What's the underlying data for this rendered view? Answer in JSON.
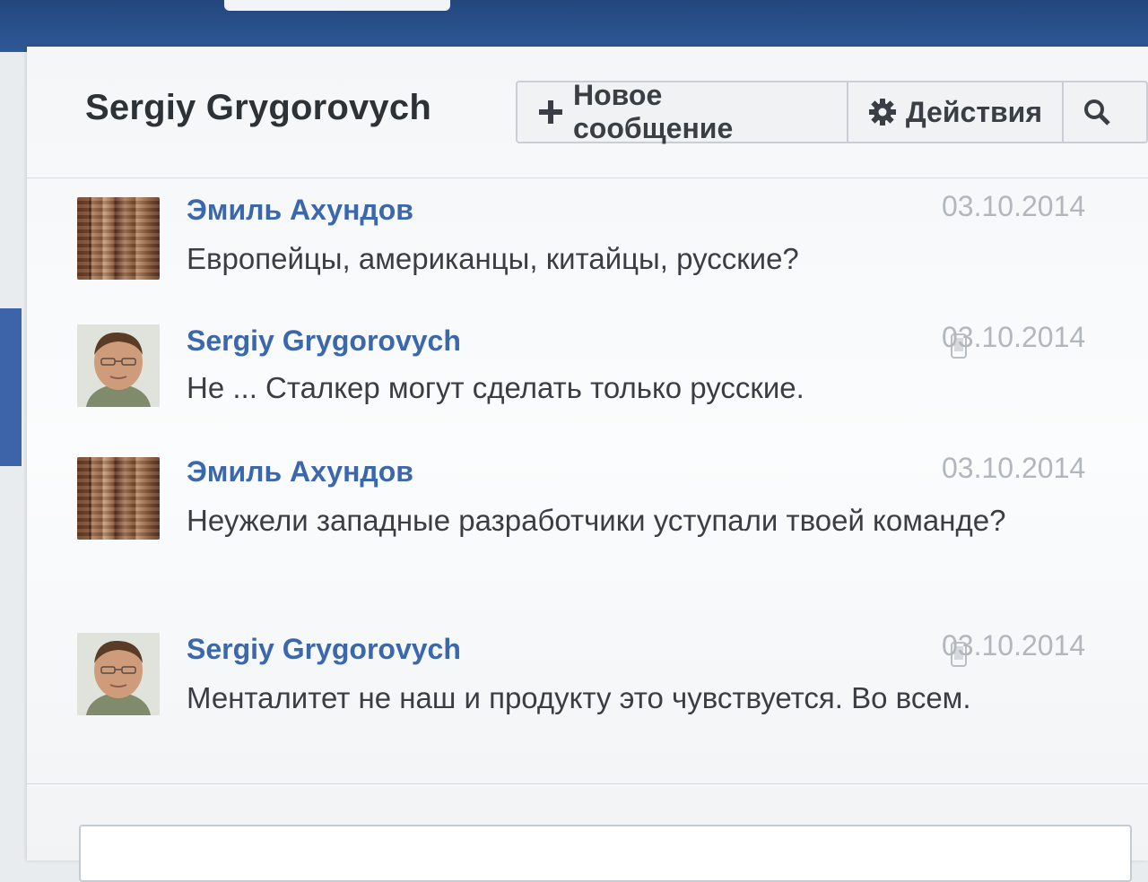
{
  "header": {
    "title": "Sergiy Grygorovych",
    "toolbar": {
      "new_message": {
        "icon": "plus-icon",
        "label": "Новое сообщение"
      },
      "actions": {
        "icon": "gear-icon",
        "label": "Действия"
      },
      "search": {
        "icon": "search-icon",
        "label": ""
      }
    }
  },
  "messages": [
    {
      "author": "Эмиль Ахундов",
      "date": "03.10.2014",
      "text": "Европейцы, американцы, китайцы, русские?",
      "avatar": "brick-photo",
      "mobile": false
    },
    {
      "author": "Sergiy Grygorovych",
      "date": "03.10.2014",
      "text": "Не ... Сталкер могут сделать только русские.",
      "avatar": "face-photo",
      "mobile": true
    },
    {
      "author": "Эмиль Ахундов",
      "date": "03.10.2014",
      "text": "Неужели западные разработчики уступали твоей команде?",
      "avatar": "brick-photo",
      "mobile": false
    },
    {
      "author": "Sergiy Grygorovych",
      "date": "03.10.2014",
      "text": "Менталитет не наш и продукту это чувствуется. Во всем.",
      "avatar": "face-photo",
      "mobile": true
    }
  ],
  "composer": {
    "placeholder": ""
  },
  "colors": {
    "brand": "#2e5896",
    "author_link": "#3b67ad",
    "date": "#b2b7bd"
  }
}
